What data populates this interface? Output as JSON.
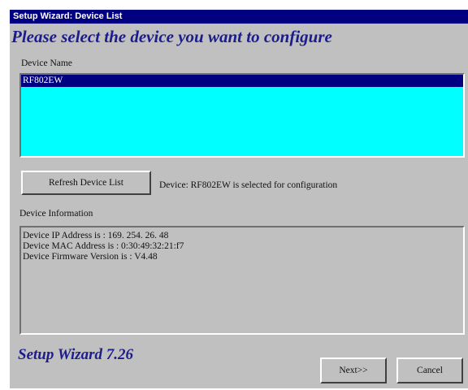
{
  "window": {
    "title": "Setup Wizard: Device List",
    "heading": "Please select the device you want to configure"
  },
  "device_list": {
    "label": "Device Name",
    "items": [
      "RF802EW"
    ],
    "selected_index": 0
  },
  "refresh_button": {
    "label": "Refresh Device List"
  },
  "status_text": "Device: RF802EW is selected for configuration",
  "info": {
    "label": "Device Information",
    "lines": [
      "Device IP Address is :  169. 254. 26. 48",
      "Device MAC Address is :  0:30:49:32:21:f7",
      "Device Firmware Version is :  V4.48"
    ]
  },
  "footer": {
    "brand": "Setup Wizard 7.26"
  },
  "buttons": {
    "next": "Next>>",
    "cancel": "Cancel"
  },
  "colors": {
    "titlebar": "#000080",
    "list_bg": "#00ffff",
    "dialog_bg": "#c0c0c0",
    "heading": "#1c1c8c"
  }
}
